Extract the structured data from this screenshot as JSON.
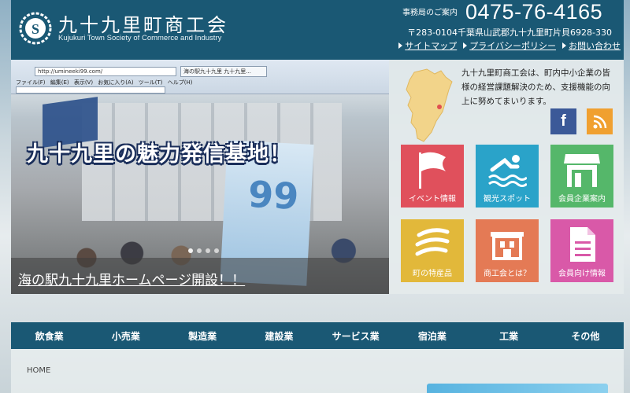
{
  "header": {
    "title": "九十九里町商工会",
    "subtitle": "Kujukuri Town Society of Commerce and Industry",
    "office_label": "事務局のご案内",
    "phone": "0475-76-4165",
    "address": "〒283-0104千葉県山武郡九十九里町片貝6928-330",
    "links": [
      {
        "label": "サイトマップ"
      },
      {
        "label": "プライバシーポリシー"
      },
      {
        "label": "お問い合わせ"
      }
    ]
  },
  "slide": {
    "tagline": "九十九里の魅力発信基地！",
    "caption": "海の駅九十九里ホームページ開設！！",
    "flag_text": "99",
    "browser": {
      "url": "http://umineeki99.com/",
      "tab": "海の駅九十九里 九十九里...",
      "menu": "ファイル(F) 編集(E) 表示(V) お気に入り(A) ツール(T) ヘルプ(H)"
    },
    "dots": 4,
    "active_dot": 0
  },
  "intro": {
    "text": "九十九里町商工会は、町内中小企業の皆様の経営課題解決のため、支援機能の向上に努めてまいります。"
  },
  "social": {
    "facebook_glyph": "f"
  },
  "tiles": [
    {
      "label": "イベント情報",
      "color": "#e0505c",
      "icon": "flag-icon"
    },
    {
      "label": "観光スポット",
      "color": "#2aa3c9",
      "icon": "swimmer-icon"
    },
    {
      "label": "会員企業案内",
      "color": "#55b76a",
      "icon": "shop-icon"
    },
    {
      "label": "町の特産品",
      "color": "#e2b83a",
      "icon": "specialty-icon"
    },
    {
      "label": "商工会とは？",
      "color": "#e47a55",
      "icon": "building-icon"
    },
    {
      "label": "会員向け情報",
      "color": "#d959a8",
      "icon": "document-icon"
    }
  ],
  "nav": [
    {
      "label": "飲食業"
    },
    {
      "label": "小売業"
    },
    {
      "label": "製造業"
    },
    {
      "label": "建設業"
    },
    {
      "label": "サービス業"
    },
    {
      "label": "宿泊業"
    },
    {
      "label": "工業"
    },
    {
      "label": "その他"
    }
  ],
  "breadcrumb": "HOME",
  "colors": {
    "header_bg": "#1a5874",
    "nav_bg": "#1a5874"
  }
}
